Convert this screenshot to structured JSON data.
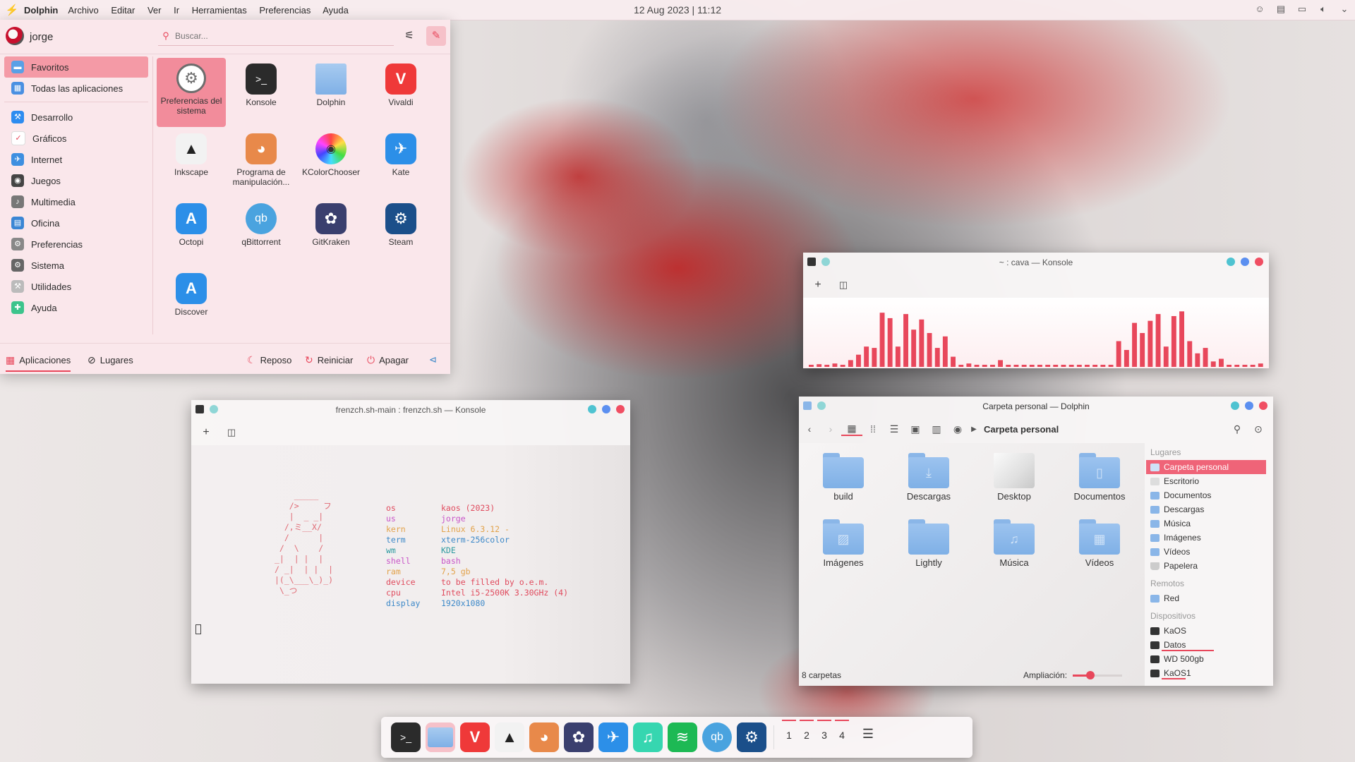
{
  "topbar": {
    "app_name": "Dolphin",
    "menus": [
      "Archivo",
      "Editar",
      "Ver",
      "Ir",
      "Herramientas",
      "Preferencias",
      "Ayuda"
    ],
    "clock": "12 Aug 2023 | 11:12"
  },
  "launcher": {
    "user": "jorge",
    "search_placeholder": "Buscar...",
    "categories": [
      {
        "label": "Favoritos",
        "icon": "favorites-icon",
        "color": "#5aa0e6"
      },
      {
        "label": "Todas las aplicaciones",
        "icon": "all-apps-icon",
        "color": "#4a90e2"
      },
      {
        "label": "Desarrollo",
        "icon": "development-icon",
        "color": "#2d8cf0"
      },
      {
        "label": "Gráficos",
        "icon": "graphics-icon",
        "color": "#e8475b"
      },
      {
        "label": "Internet",
        "icon": "internet-icon",
        "color": "#3d8fe0"
      },
      {
        "label": "Juegos",
        "icon": "games-icon",
        "color": "#444444"
      },
      {
        "label": "Multimedia",
        "icon": "multimedia-icon",
        "color": "#777777"
      },
      {
        "label": "Oficina",
        "icon": "office-icon",
        "color": "#3a86d4"
      },
      {
        "label": "Preferencias",
        "icon": "preferences-icon",
        "color": "#888888"
      },
      {
        "label": "Sistema",
        "icon": "system-icon",
        "color": "#666666"
      },
      {
        "label": "Utilidades",
        "icon": "utilities-icon",
        "color": "#bbbbbb"
      },
      {
        "label": "Ayuda",
        "icon": "help-icon",
        "color": "#3cc48c"
      }
    ],
    "apps": [
      {
        "label": "Preferencias del sistema",
        "icon": "system-settings-icon",
        "color": "#6d6d6d"
      },
      {
        "label": "Konsole",
        "icon": "konsole-icon",
        "color": "#2b2b2b"
      },
      {
        "label": "Dolphin",
        "icon": "dolphin-folder-icon",
        "color": "#8ab6e8"
      },
      {
        "label": "Vivaldi",
        "icon": "vivaldi-icon",
        "color": "#ef3939"
      },
      {
        "label": "Inkscape",
        "icon": "inkscape-icon",
        "color": "#f2f2f2"
      },
      {
        "label": "Programa de manipulación...",
        "icon": "gimp-icon",
        "color": "#e8894a"
      },
      {
        "label": "KColorChooser",
        "icon": "kcolorchooser-icon",
        "color": "#f2f2f2"
      },
      {
        "label": "Kate",
        "icon": "kate-icon",
        "color": "#2c8fe8"
      },
      {
        "label": "Octopi",
        "icon": "octopi-icon",
        "color": "#2c8fe8"
      },
      {
        "label": "qBittorrent",
        "icon": "qbittorrent-icon",
        "color": "#4aa3df"
      },
      {
        "label": "GitKraken",
        "icon": "gitkraken-icon",
        "color": "#3a3f6e"
      },
      {
        "label": "Steam",
        "icon": "steam-icon",
        "color": "#1b4f8a"
      },
      {
        "label": "Discover",
        "icon": "discover-icon",
        "color": "#2c8fe8"
      }
    ],
    "footer": {
      "tab_apps": "Aplicaciones",
      "tab_places": "Lugares",
      "sleep": "Reposo",
      "restart": "Reiniciar",
      "shutdown": "Apagar"
    }
  },
  "konsole_cava": {
    "title": "~ : cava — Konsole",
    "bars": [
      0.02,
      0.04,
      0.03,
      0.05,
      0.03,
      0.1,
      0.18,
      0.3,
      0.28,
      0.8,
      0.72,
      0.3,
      0.78,
      0.55,
      0.7,
      0.5,
      0.28,
      0.45,
      0.15,
      0.02,
      0.05,
      0.02,
      0.02,
      0.02,
      0.1,
      0.03,
      0.03,
      0.02,
      0.02,
      0.02,
      0.03,
      0.02,
      0.02,
      0.02,
      0.02,
      0.02,
      0.02,
      0.02,
      0.02,
      0.38,
      0.25,
      0.65,
      0.5,
      0.68,
      0.78,
      0.3,
      0.75,
      0.82,
      0.38,
      0.2,
      0.28,
      0.08,
      0.12,
      0.03,
      0.02,
      0.02,
      0.03,
      0.05
    ]
  },
  "konsole_frenzch": {
    "title": "frenzch.sh-main : frenzch.sh — Konsole",
    "ascii": [
      "    _____",
      "   />     フ",
      "   |  _ _|",
      "  /,ミ__X/",
      "  /      |",
      " /  \\    /",
      "_|  | |  |",
      "/ _|  | |  |",
      "|(_\\___\\_)_)",
      " \\_つ"
    ],
    "info": [
      {
        "key": "os",
        "value": "kaos (2023)",
        "kcolor": "#e04b5e",
        "vcolor": "#e04b5e"
      },
      {
        "key": "us",
        "value": "jorge",
        "kcolor": "#c855c8",
        "vcolor": "#c855c8"
      },
      {
        "key": "kern",
        "value": "Linux 6.3.12 -",
        "kcolor": "#e2a24a",
        "vcolor": "#e2a24a"
      },
      {
        "key": "term",
        "value": "xterm-256color",
        "kcolor": "#3c88c8",
        "vcolor": "#3c88c8"
      },
      {
        "key": "wm",
        "value": "KDE",
        "kcolor": "#2e9aa0",
        "vcolor": "#2e9aa0"
      },
      {
        "key": "shell",
        "value": "bash",
        "kcolor": "#c855c8",
        "vcolor": "#c855c8"
      },
      {
        "key": "ram",
        "value": "7,5 gb",
        "kcolor": "#e2a24a",
        "vcolor": "#e2a24a"
      },
      {
        "key": "device",
        "value": "to be filled by o.e.m.",
        "kcolor": "#e04b5e",
        "vcolor": "#e04b5e"
      },
      {
        "key": "cpu",
        "value": "Intel i5-2500K 3.30GHz (4)",
        "kcolor": "#e04b5e",
        "vcolor": "#e04b5e"
      },
      {
        "key": "display",
        "value": "1920x1080",
        "kcolor": "#3c88c8",
        "vcolor": "#3c88c8"
      }
    ]
  },
  "dolphin": {
    "title": "Carpeta personal — Dolphin",
    "breadcrumb": "Carpeta personal",
    "folders": [
      {
        "label": "build",
        "icon": "folder-icon",
        "glyph": ""
      },
      {
        "label": "Descargas",
        "icon": "folder-downloads-icon",
        "glyph": "⤓"
      },
      {
        "label": "Desktop",
        "icon": "folder-desktop-icon",
        "glyph": ""
      },
      {
        "label": "Documentos",
        "icon": "folder-documents-icon",
        "glyph": "▯"
      },
      {
        "label": "Imágenes",
        "icon": "folder-pictures-icon",
        "glyph": "▨"
      },
      {
        "label": "Lightly",
        "icon": "folder-icon",
        "glyph": ""
      },
      {
        "label": "Música",
        "icon": "folder-music-icon",
        "glyph": "♫"
      },
      {
        "label": "Vídeos",
        "icon": "folder-videos-icon",
        "glyph": "▦"
      }
    ],
    "status": "8 carpetas",
    "zoom_label": "Ampliación:",
    "zoom_level": 0.35,
    "places_header": "Lugares",
    "places": [
      "Carpeta personal",
      "Escritorio",
      "Documentos",
      "Descargas",
      "Música",
      "Imágenes",
      "Vídeos",
      "Papelera"
    ],
    "remote_header": "Remotos",
    "remote": [
      "Red"
    ],
    "devices_header": "Dispositivos",
    "devices": [
      {
        "label": "KaOS",
        "usage": 0
      },
      {
        "label": "Datos",
        "usage": 0.62
      },
      {
        "label": "WD 500gb",
        "usage": 0
      },
      {
        "label": "KaOS1",
        "usage": 0.28
      }
    ]
  },
  "dock": {
    "apps": [
      {
        "name": "konsole",
        "icon": "konsole-icon",
        "color": "#2b2b2b"
      },
      {
        "name": "dolphin",
        "icon": "dolphin-folder-icon",
        "color": "#8ab6e8"
      },
      {
        "name": "vivaldi",
        "icon": "vivaldi-icon",
        "color": "#ef3939"
      },
      {
        "name": "inkscape",
        "icon": "inkscape-icon",
        "color": "#f2f2f2"
      },
      {
        "name": "gimp",
        "icon": "gimp-icon",
        "color": "#e8894a"
      },
      {
        "name": "gitkraken",
        "icon": "gitkraken-icon",
        "color": "#3a3f6e"
      },
      {
        "name": "kate",
        "icon": "kate-icon",
        "color": "#2c8fe8"
      },
      {
        "name": "music",
        "icon": "music-icon",
        "color": "#36d6b0"
      },
      {
        "name": "spotify",
        "icon": "spotify-icon",
        "color": "#1db954"
      },
      {
        "name": "qbittorrent",
        "icon": "qbittorrent-icon",
        "color": "#4aa3df"
      },
      {
        "name": "steam",
        "icon": "steam-icon",
        "color": "#1b4f8a"
      }
    ],
    "desktops": [
      "1",
      "2",
      "3",
      "4"
    ]
  },
  "accent": "#e8475b"
}
